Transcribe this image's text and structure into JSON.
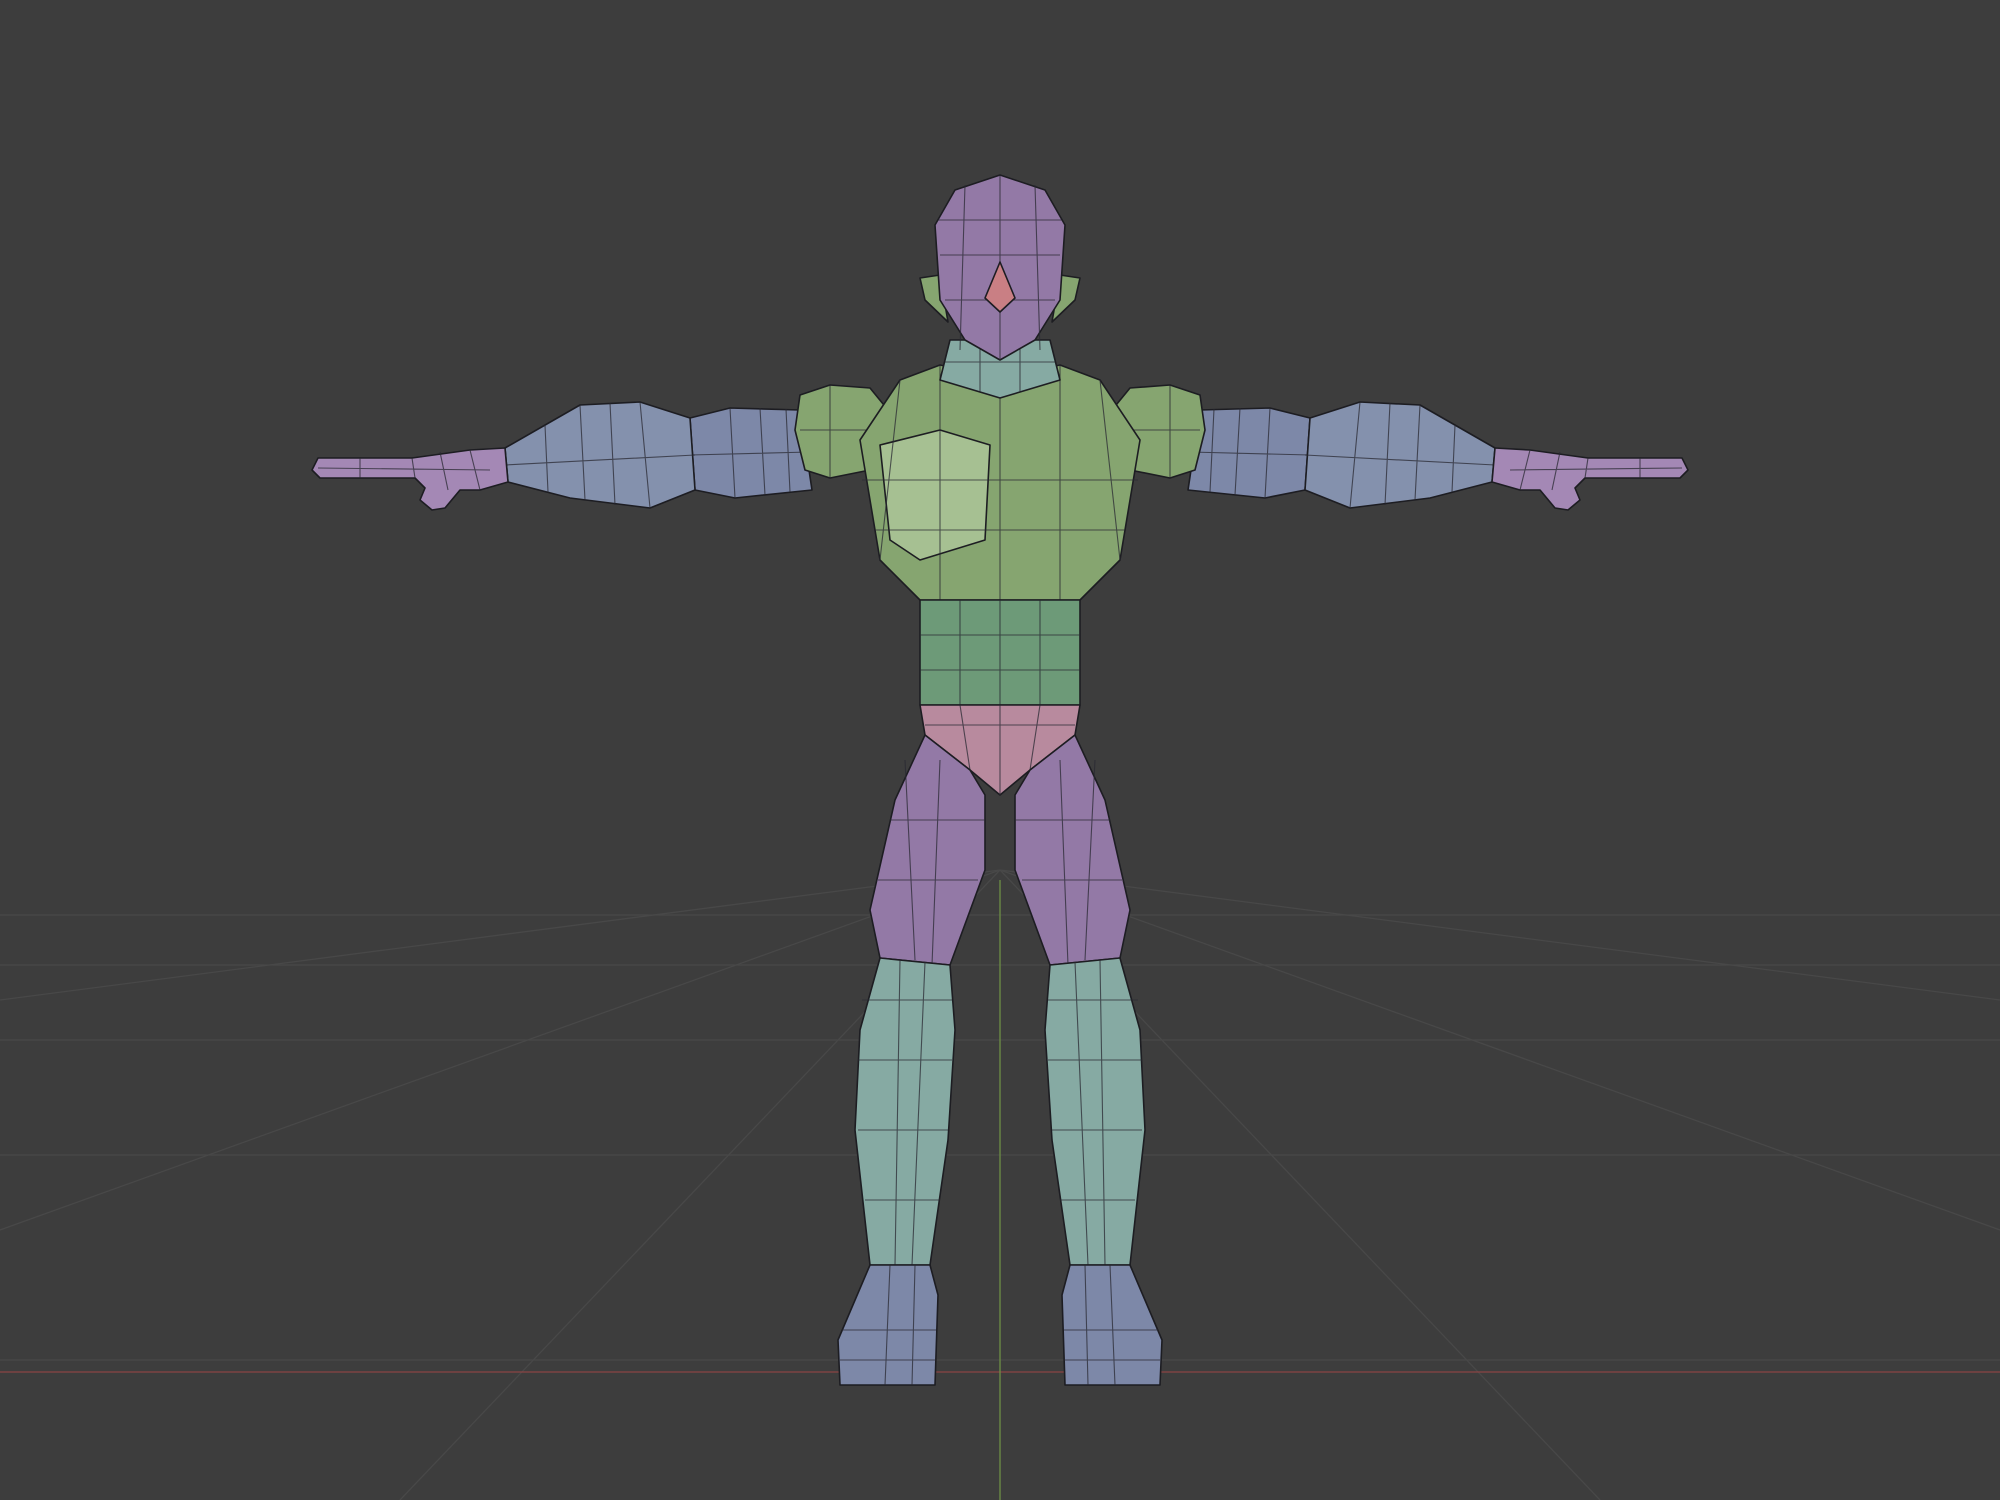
{
  "viewport": {
    "background_color": "#3d3d3d",
    "grid_color": "#484848",
    "x_axis_color": "#8a4444",
    "y_axis_color": "#6d8f45"
  },
  "model": {
    "pose": "T-pose",
    "colors": {
      "green": "#86a570",
      "green_dark": "#5f7d52",
      "green_waist": "#6d9a78",
      "teal": "#86aaa3",
      "teal_dark": "#6e938d",
      "blue": "#7d88a8",
      "blue_dark": "#5f6a8a",
      "purple": "#9379a6",
      "purple_dark": "#75608a",
      "pink": "#b88a9e",
      "nose": "#c97f84",
      "hand": "#a488b5"
    }
  }
}
